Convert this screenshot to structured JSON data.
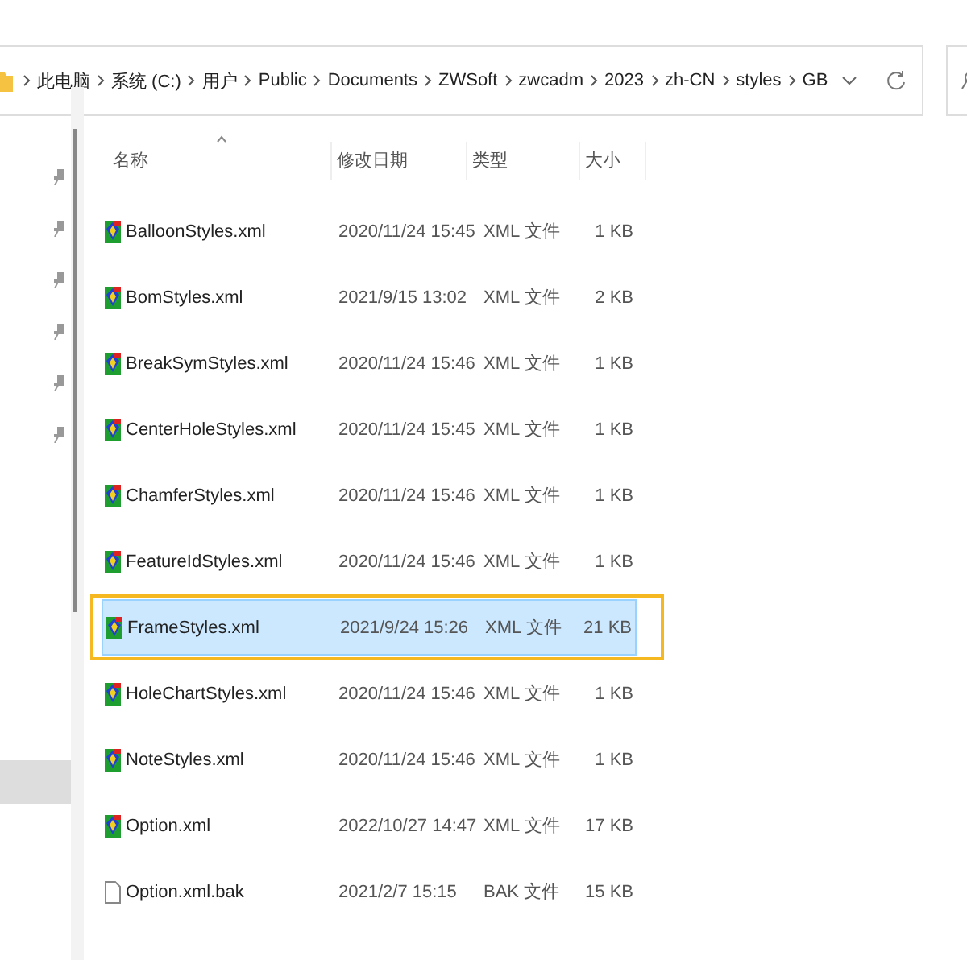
{
  "address_bar": {
    "path": [
      "此电脑",
      "系统 (C:)",
      "用户",
      "Public",
      "Documents",
      "ZWSoft",
      "zwcadm",
      "2023",
      "zh-CN",
      "styles",
      "GB"
    ]
  },
  "navigation_pane": {
    "items": [
      {
        "selected": false
      },
      {
        "selected": false
      },
      {
        "selected": false
      },
      {
        "selected": false
      },
      {
        "selected": false
      },
      {
        "selected": false
      },
      {
        "selected": true
      }
    ]
  },
  "file_list": {
    "columns": [
      "名称",
      "修改日期",
      "类型",
      "大小"
    ],
    "rows": [
      {
        "name": "BalloonStyles.xml",
        "modified": "2020/11/24 15:45",
        "type": "XML 文件",
        "size": "1 KB",
        "kind": "xml",
        "selected": false,
        "highlighted": false
      },
      {
        "name": "BomStyles.xml",
        "modified": "2021/9/15 13:02",
        "type": "XML 文件",
        "size": "2 KB",
        "kind": "xml",
        "selected": false,
        "highlighted": false
      },
      {
        "name": "BreakSymStyles.xml",
        "modified": "2020/11/24 15:46",
        "type": "XML 文件",
        "size": "1 KB",
        "kind": "xml",
        "selected": false,
        "highlighted": false
      },
      {
        "name": "CenterHoleStyles.xml",
        "modified": "2020/11/24 15:45",
        "type": "XML 文件",
        "size": "1 KB",
        "kind": "xml",
        "selected": false,
        "highlighted": false
      },
      {
        "name": "ChamferStyles.xml",
        "modified": "2020/11/24 15:46",
        "type": "XML 文件",
        "size": "1 KB",
        "kind": "xml",
        "selected": false,
        "highlighted": false
      },
      {
        "name": "FeatureIdStyles.xml",
        "modified": "2020/11/24 15:46",
        "type": "XML 文件",
        "size": "1 KB",
        "kind": "xml",
        "selected": false,
        "highlighted": false
      },
      {
        "name": "FrameStyles.xml",
        "modified": "2021/9/24 15:26",
        "type": "XML 文件",
        "size": "21 KB",
        "kind": "xml",
        "selected": true,
        "highlighted": true
      },
      {
        "name": "HoleChartStyles.xml",
        "modified": "2020/11/24 15:46",
        "type": "XML 文件",
        "size": "1 KB",
        "kind": "xml",
        "selected": false,
        "highlighted": false
      },
      {
        "name": "NoteStyles.xml",
        "modified": "2020/11/24 15:46",
        "type": "XML 文件",
        "size": "1 KB",
        "kind": "xml",
        "selected": false,
        "highlighted": false
      },
      {
        "name": "Option.xml",
        "modified": "2022/10/27 14:47",
        "type": "XML 文件",
        "size": "17 KB",
        "kind": "xml",
        "selected": false,
        "highlighted": false
      },
      {
        "name": "Option.xml.bak",
        "modified": "2021/2/7 15:15",
        "type": "BAK 文件",
        "size": "15 KB",
        "kind": "document",
        "selected": false,
        "highlighted": false
      }
    ]
  }
}
